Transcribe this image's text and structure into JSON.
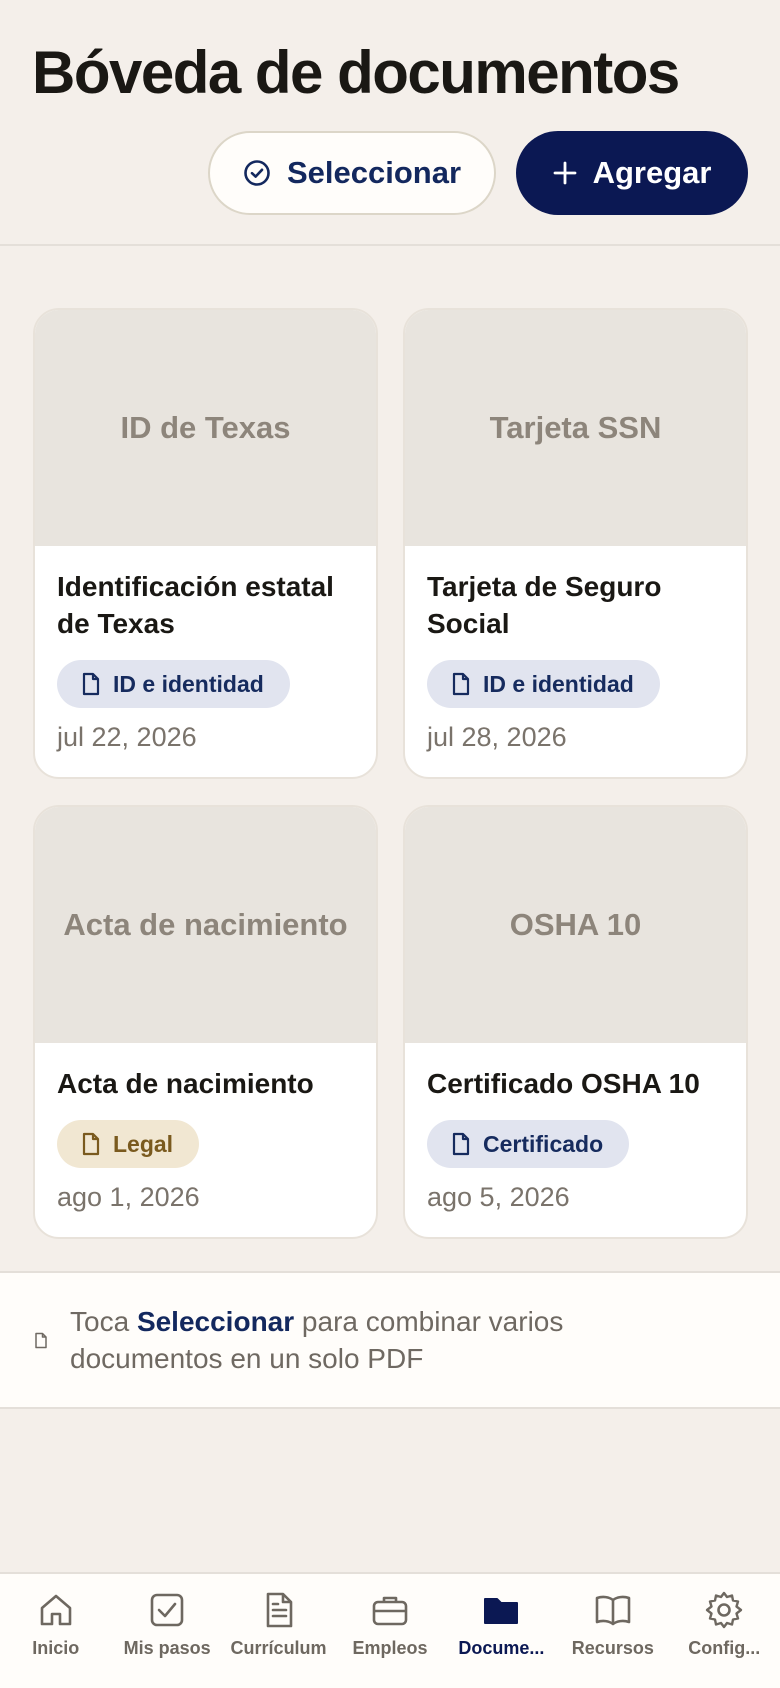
{
  "header": {
    "title": "Bóveda de documentos",
    "select_label": "Seleccionar",
    "add_label": "Agregar"
  },
  "documents": [
    {
      "thumb": "ID de Texas",
      "title": "Identificación estatal de Texas",
      "tag": "ID e identidad",
      "tag_kind": "id",
      "date": "jul 22, 2026"
    },
    {
      "thumb": "Tarjeta SSN",
      "title": "Tarjeta de Seguro Social",
      "tag": "ID e identidad",
      "tag_kind": "id",
      "date": "jul 28, 2026"
    },
    {
      "thumb": "Acta de nacimiento",
      "title": "Acta de nacimiento",
      "tag": "Legal",
      "tag_kind": "legal",
      "date": "ago 1, 2026"
    },
    {
      "thumb": "OSHA 10",
      "title": "Certificado OSHA 10",
      "tag": "Certificado",
      "tag_kind": "id",
      "date": "ago 5, 2026"
    }
  ],
  "hint": {
    "before": "Toca ",
    "strong": "Seleccionar",
    "after": " para combinar varios documentos en un solo PDF"
  },
  "nav": {
    "items": [
      {
        "label": "Inicio",
        "icon": "home-icon"
      },
      {
        "label": "Mis pasos",
        "icon": "checkbox-icon"
      },
      {
        "label": "Currículum",
        "icon": "document-icon"
      },
      {
        "label": "Empleos",
        "icon": "briefcase-icon"
      },
      {
        "label": "Docume...",
        "icon": "folder-icon",
        "active": true
      },
      {
        "label": "Recursos",
        "icon": "book-icon"
      },
      {
        "label": "Config...",
        "icon": "gear-icon"
      }
    ]
  },
  "colors": {
    "background": "#f4efea",
    "accent": "#0b1853",
    "chip_id": "#e1e4ef",
    "chip_legal": "#f1e7d2"
  }
}
